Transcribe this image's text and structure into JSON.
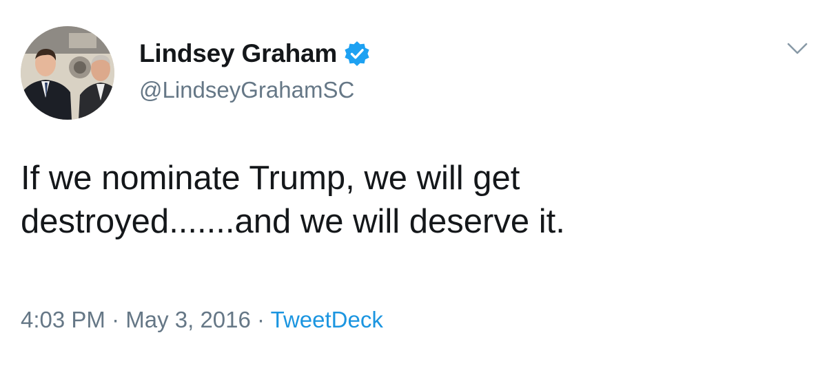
{
  "user": {
    "display_name": "Lindsey Graham",
    "handle": "@LindseyGrahamSC",
    "verified": true,
    "avatar_icon": "profile-photo"
  },
  "tweet": {
    "text_lines": [
      "If we nominate Trump, we will get",
      "destroyed.......and we will deserve it."
    ]
  },
  "meta": {
    "time": "4:03 PM",
    "separator": "·",
    "date": "May 3, 2016",
    "source": "TweetDeck"
  },
  "icons": {
    "verified": "verified-badge-icon",
    "menu": "chevron-down-icon"
  },
  "colors": {
    "text": "#14171a",
    "secondary": "#657786",
    "accent": "#1b95e0",
    "verified": "#1da1f2"
  }
}
